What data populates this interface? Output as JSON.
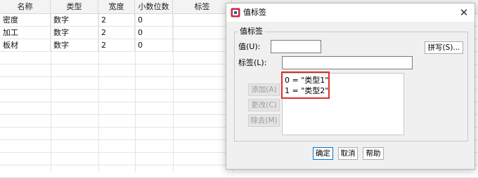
{
  "grid": {
    "headers": [
      "名称",
      "类型",
      "宽度",
      "小数位数",
      "标签"
    ],
    "rows": [
      [
        "密度",
        "数字",
        "2",
        "0",
        ""
      ],
      [
        "加工",
        "数字",
        "2",
        "0",
        ""
      ],
      [
        "板材",
        "数字",
        "2",
        "0",
        ""
      ]
    ]
  },
  "dialog": {
    "title": "值标签",
    "close_icon": "close-icon",
    "group_title": "值标签",
    "value_label": "值(U):",
    "value_field": "",
    "label_label": "标签(L):",
    "label_field": "",
    "spell_button": "拼写(S)...",
    "add_button": "添加(A)",
    "change_button": "更改(C)",
    "remove_button": "除去(M)",
    "list_items": [
      "0 = \"类型1\"",
      "1 = \"类型2\""
    ],
    "ok_button": "确定",
    "cancel_button": "取消",
    "help_button": "帮助",
    "highlight_color": "#d9302b"
  }
}
